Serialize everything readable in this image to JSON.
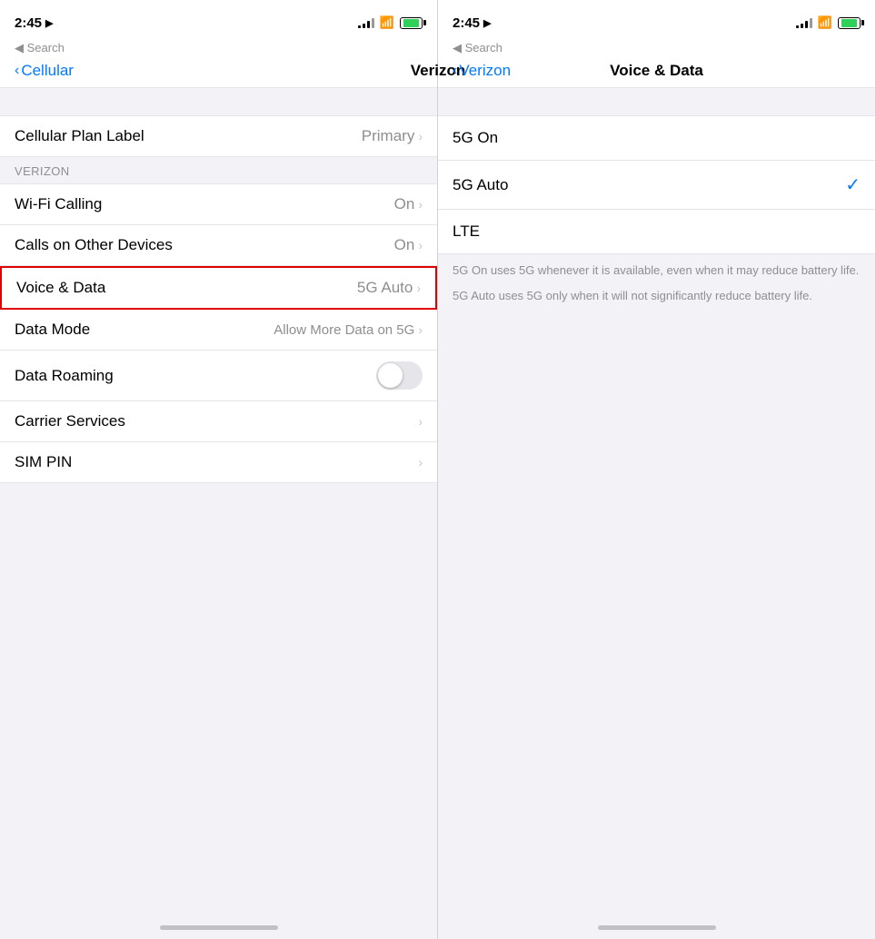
{
  "left_screen": {
    "status": {
      "time": "2:45",
      "location_icon": "▶",
      "search_back": "◀ Search"
    },
    "nav": {
      "back_label": "Cellular",
      "title": "Verizon"
    },
    "cellular_plan": {
      "label": "Cellular Plan Label",
      "value": "Primary"
    },
    "section_header": "VERIZON",
    "items": [
      {
        "label": "Wi-Fi Calling",
        "value": "On",
        "has_chevron": true
      },
      {
        "label": "Calls on Other Devices",
        "value": "On",
        "has_chevron": true
      },
      {
        "label": "Voice & Data",
        "value": "5G Auto",
        "has_chevron": true,
        "highlighted": true
      },
      {
        "label": "Data Mode",
        "value": "Allow More Data on 5G",
        "has_chevron": true
      },
      {
        "label": "Data Roaming",
        "value": "",
        "toggle": true
      },
      {
        "label": "Carrier Services",
        "value": "",
        "has_chevron": true
      },
      {
        "label": "SIM PIN",
        "value": "",
        "has_chevron": true
      }
    ]
  },
  "right_screen": {
    "status": {
      "time": "2:45",
      "search_back": "◀ Search"
    },
    "nav": {
      "back_label": "Verizon",
      "title": "Voice & Data"
    },
    "options": [
      {
        "label": "5G On",
        "selected": false
      },
      {
        "label": "5G Auto",
        "selected": true
      },
      {
        "label": "LTE",
        "selected": false
      }
    ],
    "descriptions": [
      "5G On uses 5G whenever it is available, even when it may reduce battery life.",
      "5G Auto uses 5G only when it will not significantly reduce battery life."
    ]
  }
}
